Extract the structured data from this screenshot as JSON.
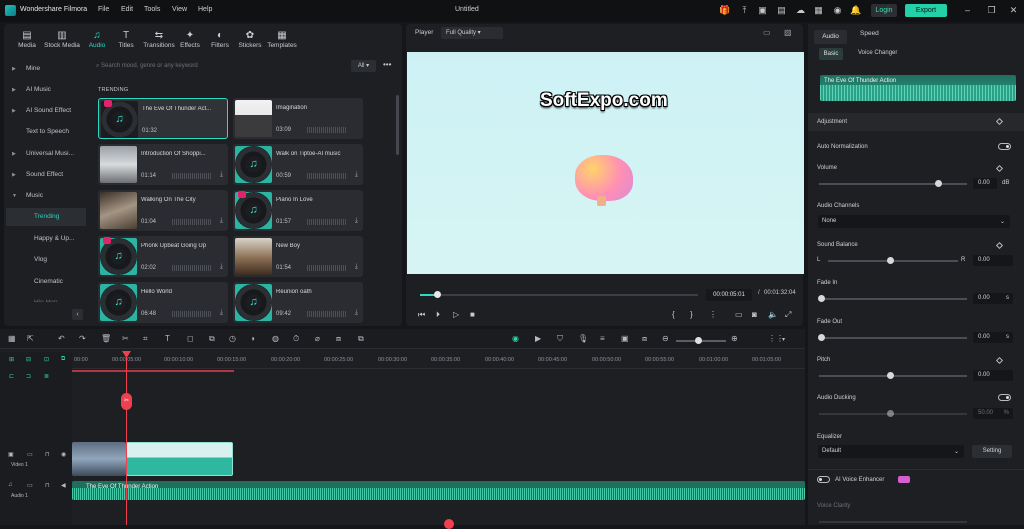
{
  "window": {
    "app_name": "Wondershare Filmora",
    "doc_title": "Untitled",
    "menu": [
      "File",
      "Edit",
      "Tools",
      "View",
      "Help"
    ],
    "login": "Login",
    "export": "Export"
  },
  "toolbar": [
    {
      "label": "Media",
      "icon": "media-icon"
    },
    {
      "label": "Stock Media",
      "icon": "stock-media-icon"
    },
    {
      "label": "Audio",
      "icon": "audio-icon"
    },
    {
      "label": "Titles",
      "icon": "titles-icon"
    },
    {
      "label": "Transitions",
      "icon": "transitions-icon"
    },
    {
      "label": "Effects",
      "icon": "effects-icon"
    },
    {
      "label": "Filters",
      "icon": "filters-icon"
    },
    {
      "label": "Stickers",
      "icon": "stickers-icon"
    },
    {
      "label": "Templates",
      "icon": "templates-icon"
    }
  ],
  "sidebar": {
    "mine": "Mine",
    "ai_music": "AI Music",
    "ai_sound": "AI Sound Effect",
    "tts": "Text to Speech",
    "universal": "Universal Musi...",
    "sound_effect": "Sound Effect",
    "music": "Music",
    "trending": "Trending",
    "happy": "Happy & Up...",
    "vlog": "Vlog",
    "cinematic": "Cinematic",
    "more": "Hip Hop"
  },
  "search": {
    "placeholder": "Search mood, genre or any keyword",
    "filter": "All"
  },
  "section": "TRENDING",
  "tracks": [
    {
      "title": "The Eve Of Thunder Act...",
      "duration": "01:32"
    },
    {
      "title": "Imagination",
      "duration": "03:09"
    },
    {
      "title": "Introduction Of Shoppi...",
      "duration": "01:14"
    },
    {
      "title": "Walk on Tiptoe-AI music",
      "duration": "00:59"
    },
    {
      "title": "Walking On The City",
      "duration": "01:04"
    },
    {
      "title": "Piano In Love",
      "duration": "01:57"
    },
    {
      "title": "Phonk Upbeat Going Up",
      "duration": "02:02"
    },
    {
      "title": "New Boy",
      "duration": "01:54"
    },
    {
      "title": "Hello World",
      "duration": "06:48"
    },
    {
      "title": "Reunion oath",
      "duration": "09:42"
    }
  ],
  "player": {
    "label": "Player",
    "quality": "Full Quality",
    "watermark": "SoftExpo.com",
    "time_current": "00:00:05:01",
    "separator": "/",
    "time_total": "00:01:32:04",
    "progress": 0.06
  },
  "props": {
    "tab_audio": "Audio",
    "tab_speed": "Speed",
    "sub_basic": "Basic",
    "sub_voice": "Voice Changer",
    "clip_name": "The Eve Of Thunder Action",
    "adjustment": "Adjustment",
    "auto_norm": "Auto Normalization",
    "volume": "Volume",
    "volume_val": "0.00",
    "volume_unit": "dB",
    "channels": "Audio Channels",
    "channels_val": "None",
    "balance": "Sound Balance",
    "balance_l": "L",
    "balance_r": "R",
    "balance_val": "0.00",
    "fade_in": "Fade In",
    "fade_in_val": "0.00",
    "fade_in_unit": "s",
    "fade_out": "Fade Out",
    "fade_out_val": "0.00",
    "fade_out_unit": "s",
    "pitch": "Pitch",
    "pitch_val": "0.00",
    "ducking": "Audio Ducking",
    "ducking_val": "50.00",
    "ducking_unit": "%",
    "equalizer": "Equalizer",
    "eq_val": "Default",
    "eq_btn": "Setting",
    "enhancer": "AI Voice Enhancer",
    "clarity": "Voice Clarity"
  },
  "timeline": {
    "ticks": [
      "00:00",
      "00:00:05:00",
      "00:00:10:00",
      "00:00:15:00",
      "00:00:20:00",
      "00:00:25:00",
      "00:00:30:00",
      "00:00:35:00",
      "00:00:40:00",
      "00:00:45:00",
      "00:00:50:00",
      "00:00:55:00",
      "00:01:00:00",
      "00:01:05:00"
    ],
    "video_track": "Video 1",
    "audio_track": "Audio 1",
    "audio_clip": "The Eve Of Thunder Action"
  }
}
